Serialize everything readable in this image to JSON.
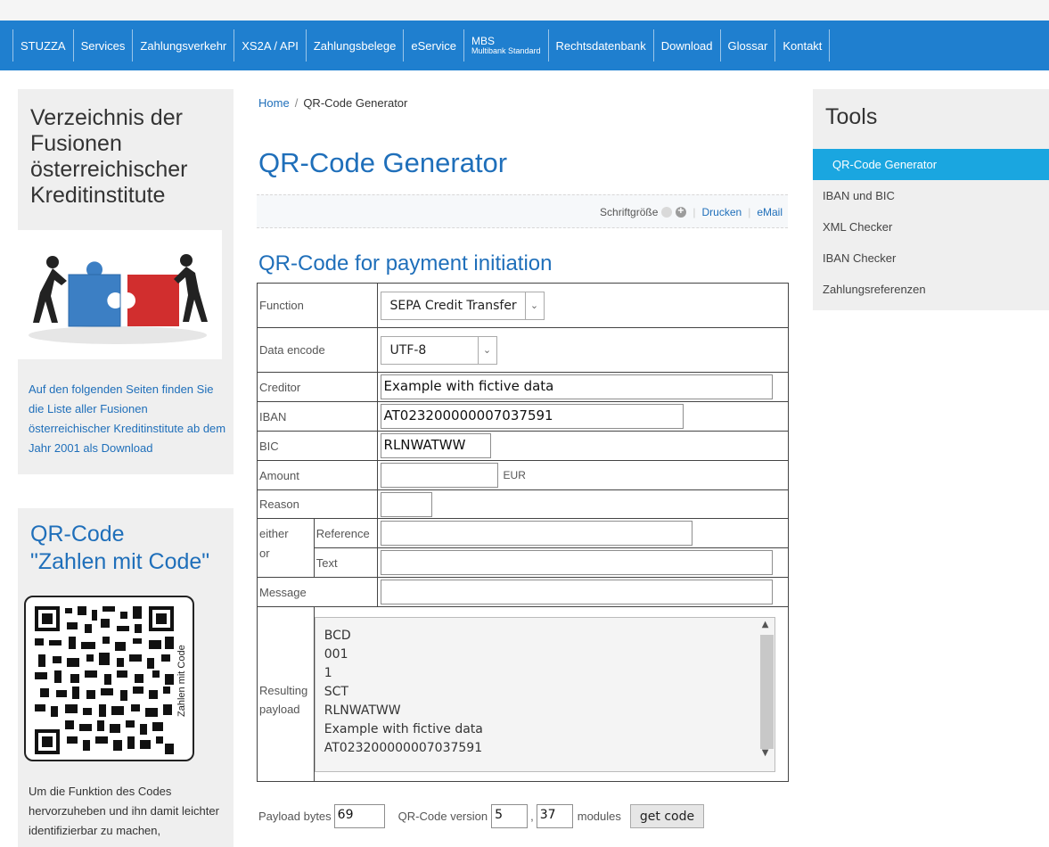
{
  "nav": {
    "items": [
      "STUZZA",
      "Services",
      "Zahlungsverkehr",
      "XS2A / API",
      "Zahlungsbelege",
      "eService"
    ],
    "mbs_top": "MBS",
    "mbs_bottom": "Multibank Standard",
    "items2": [
      "Rechtsdatenbank",
      "Download",
      "Glossar",
      "Kontakt"
    ]
  },
  "left": {
    "title1": "Verzeichnis der Fusionen österreichischer Kreditinstitute",
    "text1": "Auf den folgenden Seiten finden Sie die Liste aller Fusionen österreichischer Kreditinstitute ab dem Jahr 2001 als Download",
    "title2_line1": "QR-Code",
    "title2_line2": "\"Zahlen mit Code\"",
    "qr_label": "Zahlen mit Code",
    "text2": "Um die Funktion des Codes hervorzuheben und ihn damit leichter identifizierbar zu machen,"
  },
  "breadcrumb": {
    "home": "Home",
    "separator": "/",
    "current": "QR-Code Generator"
  },
  "page_title": "QR-Code Generator",
  "toolbar": {
    "font_size_label": "Schriftgröße",
    "print": "Drucken",
    "email": "eMail"
  },
  "section_title": "QR-Code for payment initiation",
  "form": {
    "function_label": "Function",
    "function_value": "SEPA Credit Transfer",
    "encode_label": "Data encode",
    "encode_value": "UTF-8",
    "creditor_label": "Creditor",
    "creditor_value": "Example with fictive data",
    "iban_label": "IBAN",
    "iban_value": "AT023200000007037591",
    "bic_label": "BIC",
    "bic_value": "RLNWATWW",
    "amount_label": "Amount",
    "amount_value": "",
    "amount_currency": "EUR",
    "reason_label": "Reason",
    "reason_value": "",
    "either_label": "either",
    "or_label": "or",
    "reference_label": "Reference",
    "reference_value": "",
    "text_label": "Text",
    "text_value": "",
    "message_label": "Message",
    "message_value": "",
    "payload_label_1": "Resulting",
    "payload_label_2": "payload",
    "payload_lines": [
      "BCD",
      "001",
      "1",
      "SCT",
      "RLNWATWW",
      "Example with fictive data",
      "AT023200000007037591"
    ]
  },
  "bottom": {
    "bytes_label": "Payload bytes",
    "bytes_value": "69",
    "version_label": "QR-Code version",
    "version_value": "5",
    "modules_value": "37",
    "modules_label": "modules",
    "get_code": "get code"
  },
  "tools": {
    "title": "Tools",
    "items": [
      "QR-Code Generator",
      "IBAN und BIC",
      "XML Checker",
      "IBAN Checker",
      "Zahlungsreferenzen"
    ],
    "active_index": 0
  },
  "colors": {
    "nav_bg": "#1f7fcf",
    "link_blue": "#1f6fba",
    "active_tool": "#1aa6e0",
    "sidebar_bg": "#efefef"
  }
}
